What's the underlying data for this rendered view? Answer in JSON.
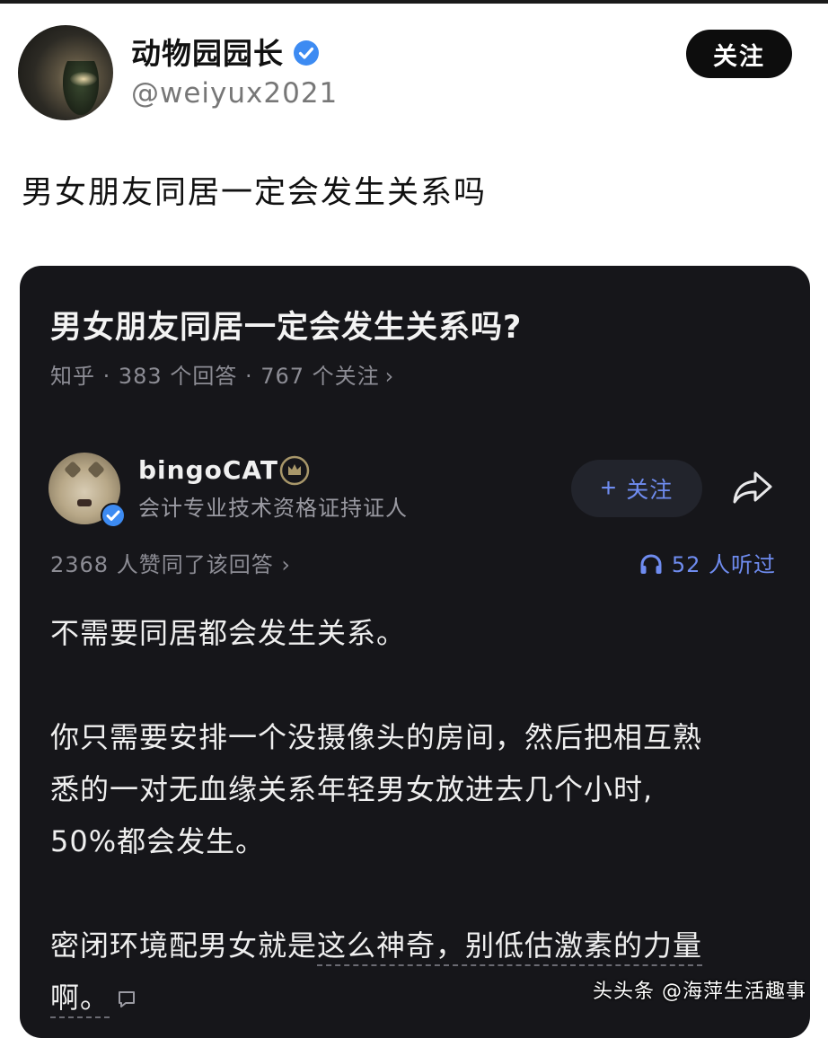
{
  "post": {
    "user_name": "动物园园长",
    "handle": "@weiyux2021",
    "follow_label": "关注",
    "text": "男女朋友同居一定会发生关系吗"
  },
  "card": {
    "question_title": "男女朋友同居一定会发生关系吗?",
    "meta": "知乎 · 383 个回答 · 767 个关注",
    "answerer": {
      "name": "bingoCAT",
      "title": "会计专业技术资格证持证人",
      "follow_label": "关注"
    },
    "agree_text": "2368 人赞同了该回答",
    "listened_text": "52 人听过",
    "body": {
      "p1": "不需要同居都会发生关系。",
      "p2_line1": "你只需要安排一个没摄像头的房间，然后把相互熟",
      "p2_line2": "悉的一对无血缘关系年轻男女放进去几个小时,",
      "p2_line3": "50%都会发生。",
      "p3_lead": "密闭环境配男女就是",
      "p3_dotted": "这么神奇，别低估激素的力量",
      "p3_tail": "啊。"
    }
  },
  "watermark": "头头条 @海萍生活趣事",
  "colors": {
    "card_bg": "#16161a",
    "accent_blue": "#6f8cf0",
    "verified_blue": "#3d8bf2",
    "follow_btn_bg": "#0d0d0d"
  },
  "icons": [
    "verified-icon",
    "badge-icon",
    "plus-icon",
    "share-icon",
    "headphones-icon",
    "comment-icon",
    "chevron-right-icon"
  ]
}
